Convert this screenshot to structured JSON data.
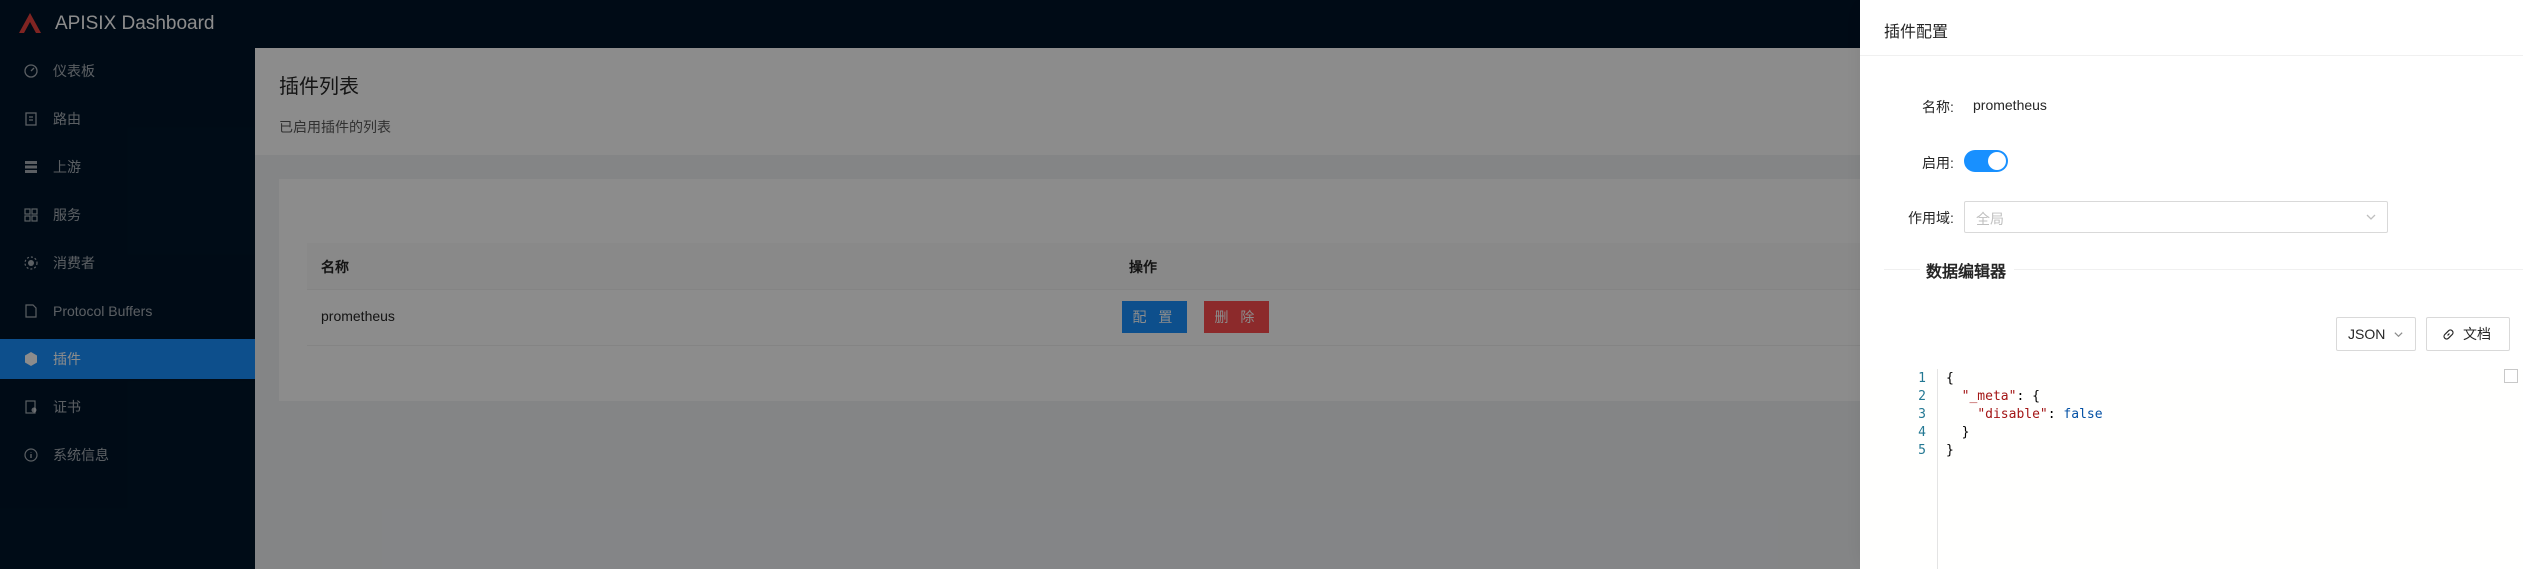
{
  "header": {
    "app_title": "APISIX Dashboard",
    "logo_color": "#e8433e"
  },
  "sidebar": {
    "items": [
      {
        "label": "仪表板",
        "icon": "dashboard-icon"
      },
      {
        "label": "路由",
        "icon": "route-icon"
      },
      {
        "label": "上游",
        "icon": "upstream-icon"
      },
      {
        "label": "服务",
        "icon": "service-icon"
      },
      {
        "label": "消费者",
        "icon": "consumer-icon"
      },
      {
        "label": "Protocol Buffers",
        "icon": "file-icon"
      },
      {
        "label": "插件",
        "icon": "plugin-icon",
        "active": true
      },
      {
        "label": "证书",
        "icon": "certificate-icon"
      },
      {
        "label": "系统信息",
        "icon": "info-icon"
      }
    ]
  },
  "page": {
    "title": "插件列表",
    "subtitle": "已启用插件的列表",
    "table": {
      "columns": [
        "名称",
        "操作"
      ],
      "rows": [
        {
          "name": "prometheus",
          "config_label": "配 置",
          "delete_label": "删 除"
        }
      ]
    }
  },
  "drawer": {
    "title": "插件配置",
    "name_label": "名称:",
    "name_value": "prometheus",
    "enable_label": "启用:",
    "enabled": true,
    "scope_label": "作用域:",
    "scope_placeholder": "全局",
    "editor_section_title": "数据编辑器",
    "format_select": "JSON",
    "doc_button": "文档",
    "code_lines": [
      "{",
      "  \"_meta\": {",
      "    \"disable\": false",
      "  }",
      "}"
    ],
    "line_numbers": [
      "1",
      "2",
      "3",
      "4",
      "5"
    ]
  },
  "colors": {
    "primary": "#1890ff",
    "danger": "#ff4d4f",
    "sider": "#001529"
  }
}
